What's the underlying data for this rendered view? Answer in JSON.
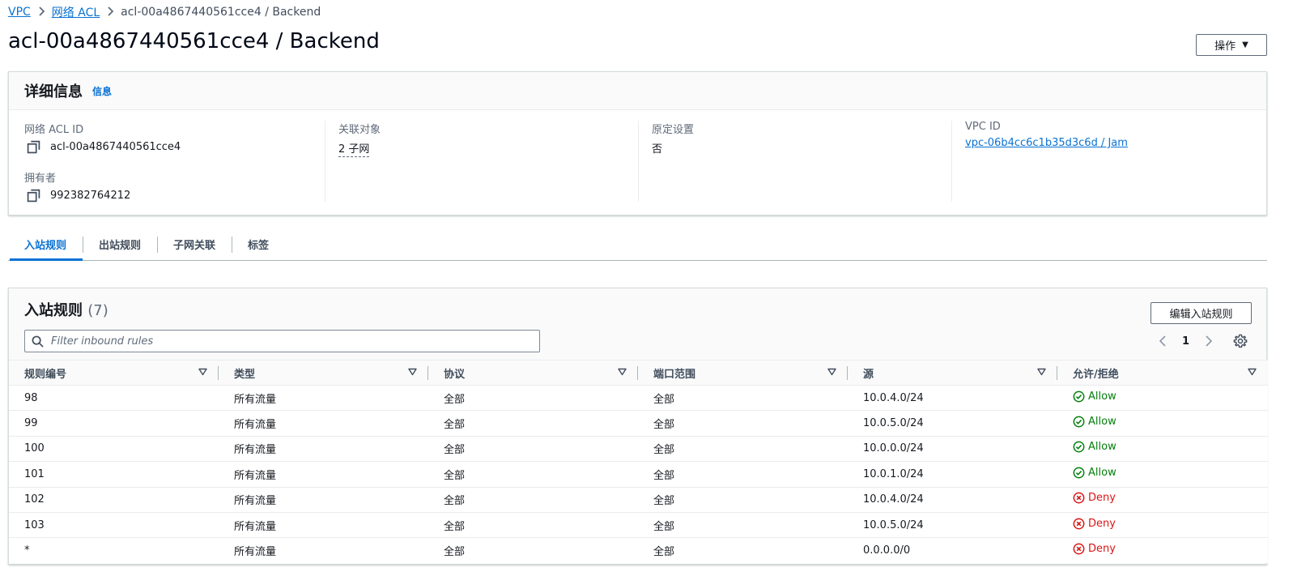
{
  "breadcrumb": {
    "items": [
      {
        "label": "VPC"
      },
      {
        "label": "网络 ACL"
      }
    ],
    "current": "acl-00a4867440561cce4 / Backend"
  },
  "page_title": "acl-00a4867440561cce4 / Backend",
  "actions_label": "操作",
  "details": {
    "title": "详细信息",
    "info_label": "信息",
    "acl_id_key": "网络 ACL ID",
    "acl_id_value": "acl-00a4867440561cce4",
    "owner_key": "拥有者",
    "owner_value": "992382764212",
    "associated_key": "关联对象",
    "associated_value": "2 子网",
    "default_key": "原定设置",
    "default_value": "否",
    "vpc_key": "VPC ID",
    "vpc_value": "vpc-06b4cc6c1b35d3c6d / Jam"
  },
  "tabs": [
    {
      "label": "入站规则"
    },
    {
      "label": "出站规则"
    },
    {
      "label": "子网关联"
    },
    {
      "label": "标签"
    }
  ],
  "rules": {
    "title": "入站规则",
    "count": "(7)",
    "edit_label": "编辑入站规则",
    "filter_placeholder": "Filter inbound rules",
    "page": "1",
    "columns": [
      "规则编号",
      "类型",
      "协议",
      "端口范围",
      "源",
      "允许/拒绝"
    ],
    "rows": [
      {
        "number": "98",
        "type": "所有流量",
        "protocol": "全部",
        "port": "全部",
        "source": "10.0.4.0/24",
        "action": "Allow"
      },
      {
        "number": "99",
        "type": "所有流量",
        "protocol": "全部",
        "port": "全部",
        "source": "10.0.5.0/24",
        "action": "Allow"
      },
      {
        "number": "100",
        "type": "所有流量",
        "protocol": "全部",
        "port": "全部",
        "source": "10.0.0.0/24",
        "action": "Allow"
      },
      {
        "number": "101",
        "type": "所有流量",
        "protocol": "全部",
        "port": "全部",
        "source": "10.0.1.0/24",
        "action": "Allow"
      },
      {
        "number": "102",
        "type": "所有流量",
        "protocol": "全部",
        "port": "全部",
        "source": "10.0.4.0/24",
        "action": "Deny"
      },
      {
        "number": "103",
        "type": "所有流量",
        "protocol": "全部",
        "port": "全部",
        "source": "10.0.5.0/24",
        "action": "Deny"
      },
      {
        "number": "*",
        "type": "所有流量",
        "protocol": "全部",
        "port": "全部",
        "source": "0.0.0.0/0",
        "action": "Deny"
      }
    ]
  },
  "colors": {
    "link": "#0972d3",
    "allow": "#037f0c",
    "deny": "#d91515"
  }
}
